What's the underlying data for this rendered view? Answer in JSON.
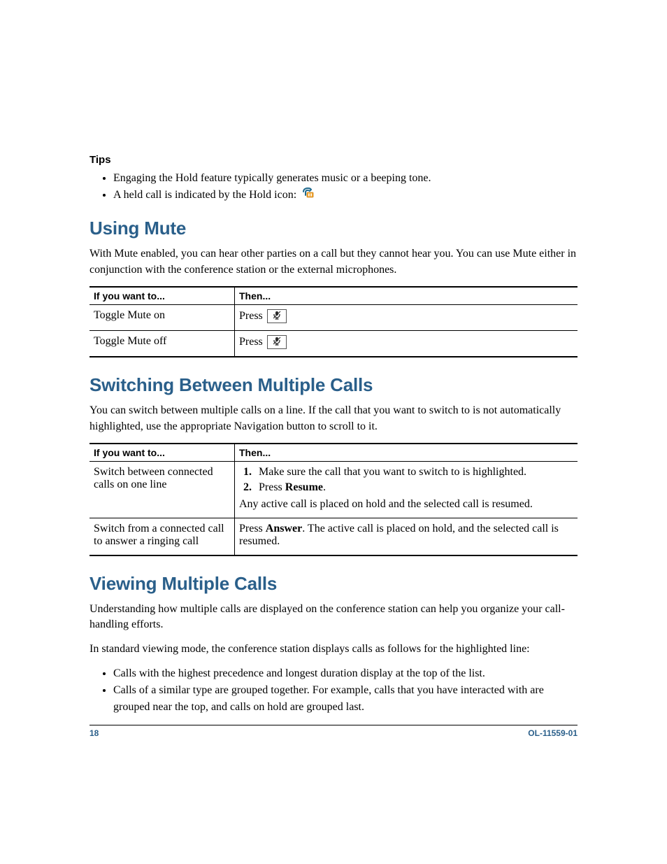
{
  "tips": {
    "heading": "Tips",
    "items": [
      "Engaging the Hold feature typically generates music or a beeping tone.",
      "A held call is indicated by the Hold icon:"
    ]
  },
  "mute": {
    "title": "Using Mute",
    "intro": "With Mute enabled, you can hear other parties on a call but they cannot hear you. You can use Mute either in conjunction with the conference station or the external microphones.",
    "table": {
      "headers": [
        "If you want to...",
        "Then..."
      ],
      "rows": [
        {
          "want": "Toggle Mute on",
          "then_prefix": "Press"
        },
        {
          "want": "Toggle Mute off",
          "then_prefix": "Press"
        }
      ]
    }
  },
  "switching": {
    "title": "Switching Between Multiple Calls",
    "intro": "You can switch between multiple calls on a line. If the call that you want to switch to is not automatically highlighted, use the appropriate Navigation button to scroll to it.",
    "table": {
      "headers": [
        "If you want to...",
        "Then..."
      ],
      "rows": [
        {
          "want": "Switch between connected calls on one line",
          "step1": "Make sure the call that you want to switch to is highlighted.",
          "step2_prefix": "Press ",
          "step2_bold": "Resume",
          "step2_suffix": ".",
          "note": "Any active call is placed on hold and the selected call is resumed."
        },
        {
          "want": "Switch from a connected call to answer a ringing call",
          "then_prefix": "Press ",
          "then_bold": "Answer",
          "then_suffix": ". The active call is placed on hold, and the selected call is resumed."
        }
      ]
    }
  },
  "viewing": {
    "title": "Viewing Multiple Calls",
    "p1": "Understanding how multiple calls are displayed on the conference station can help you organize your call-handling efforts.",
    "p2": "In standard viewing mode, the conference station displays calls as follows for the highlighted line:",
    "bullets": [
      "Calls with the highest precedence and longest duration display at the top of the list.",
      "Calls of a similar type are grouped together. For example, calls that you have interacted with are grouped near the top, and calls on hold are grouped last."
    ]
  },
  "footer": {
    "page": "18",
    "doc_id": "OL-11559-01"
  }
}
